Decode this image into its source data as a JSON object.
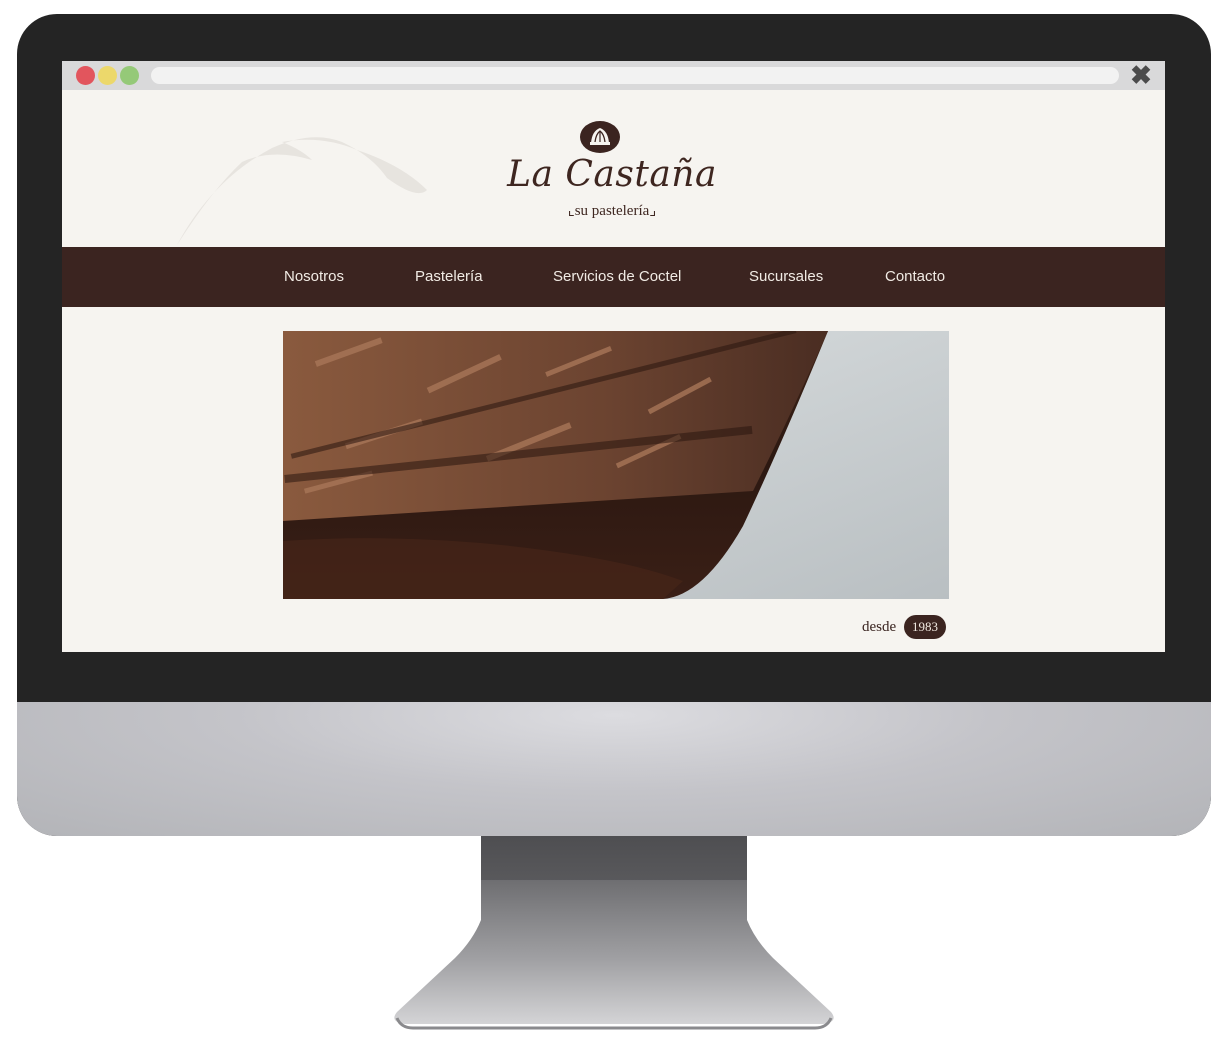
{
  "brand": {
    "name": "La Castaña",
    "tagline": "su pastelería"
  },
  "nav": {
    "items": [
      {
        "label": "Nosotros"
      },
      {
        "label": "Pastelería"
      },
      {
        "label": "Servicios de Coctel"
      },
      {
        "label": "Sucursales"
      },
      {
        "label": "Contacto"
      }
    ]
  },
  "hero": {
    "image": "chocolate-cake-photo"
  },
  "since": {
    "label": "desde",
    "year": "1983"
  },
  "browser": {
    "close_icon": "close-icon"
  },
  "colors": {
    "brand_brown": "#3b2420",
    "page_background": "#f6f4f0",
    "dot_red": "#e2555d",
    "dot_yellow": "#ecd86b",
    "dot_green": "#95c978"
  }
}
